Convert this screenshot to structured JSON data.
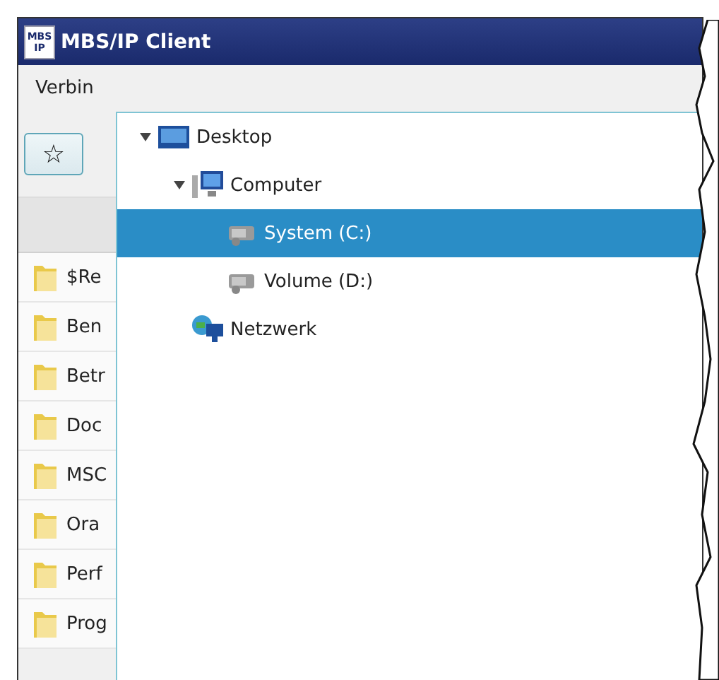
{
  "window": {
    "title": "MBS/IP Client",
    "app_icon": {
      "top": "MBS",
      "bottom": "IP"
    }
  },
  "menu": [
    {
      "label": "Verbin"
    }
  ],
  "toolbar": {
    "favorite_button": "☆"
  },
  "files": [
    {
      "name": "$Re"
    },
    {
      "name": "Ben"
    },
    {
      "name": "Betr"
    },
    {
      "name": "Doc"
    },
    {
      "name": "MSC"
    },
    {
      "name": "Ora"
    },
    {
      "name": "Perf"
    },
    {
      "name": "Prog"
    }
  ],
  "location_popup": {
    "tree": [
      {
        "label": "Desktop",
        "kind": "desktop",
        "expanded": true,
        "selected": false,
        "children": [
          {
            "label": "Computer",
            "kind": "computer",
            "expanded": true,
            "selected": false,
            "children": [
              {
                "label": "System (C:)",
                "kind": "drive",
                "selected": true
              },
              {
                "label": "Volume (D:)",
                "kind": "drive",
                "selected": false
              }
            ]
          },
          {
            "label": "Netzwerk",
            "kind": "network",
            "selected": false
          }
        ]
      }
    ]
  }
}
